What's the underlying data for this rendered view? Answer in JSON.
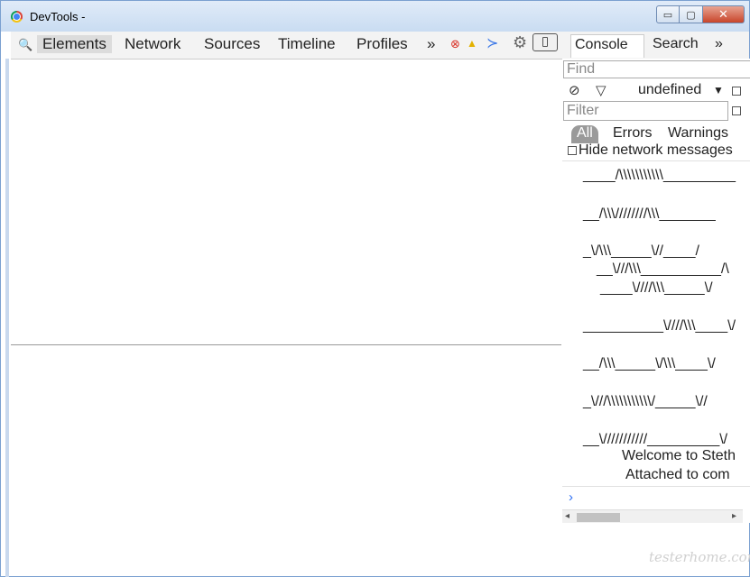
{
  "window": {
    "title": "DevTools -",
    "min_glyph": "▭",
    "max_glyph": "▢",
    "close_glyph": "✕"
  },
  "toolbar": {
    "search_glyph": "🔍",
    "tabs": [
      "Elements",
      "Network",
      "Sources",
      "Timeline",
      "Profiles"
    ],
    "more_glyph": "»",
    "error_glyph": "⊗",
    "warning_glyph": "▲",
    "console_glyph": "≻",
    "settings_glyph": "⚙"
  },
  "drawer": {
    "tabs": [
      "Console",
      "Search"
    ],
    "more_glyph": "»"
  },
  "console": {
    "find_placeholder": "Find",
    "clear_glyph": "⊘",
    "filter_glyph": "▽",
    "context_value": "undefined",
    "context_arrow": "▼",
    "filter_placeholder": "Filter",
    "levels": [
      "All",
      "Errors",
      "Warnings"
    ],
    "hide_network_label": "Hide network messages",
    "lines": [
      "____/\\\\\\\\\\\\\\\\\\\\\\_________",
      "__/\\\\\\////////\\\\\\_______",
      "_\\/\\\\\\_____\\//____/",
      "__\\///\\\\\\__________/\\",
      "____\\////\\\\\\_____\\/",
      "__________\\////\\\\\\____\\/",
      "__/\\\\\\_____\\/\\\\\\____\\/",
      "_\\///\\\\\\\\\\\\\\\\\\\\\\/_____\\//",
      "__\\///////////_________\\/",
      "Welcome to Steth",
      "Attached to com"
    ],
    "prompt_glyph": "›",
    "scroll_left_glyph": "◂",
    "scroll_right_glyph": "▸"
  },
  "watermark": "testerhome.com"
}
